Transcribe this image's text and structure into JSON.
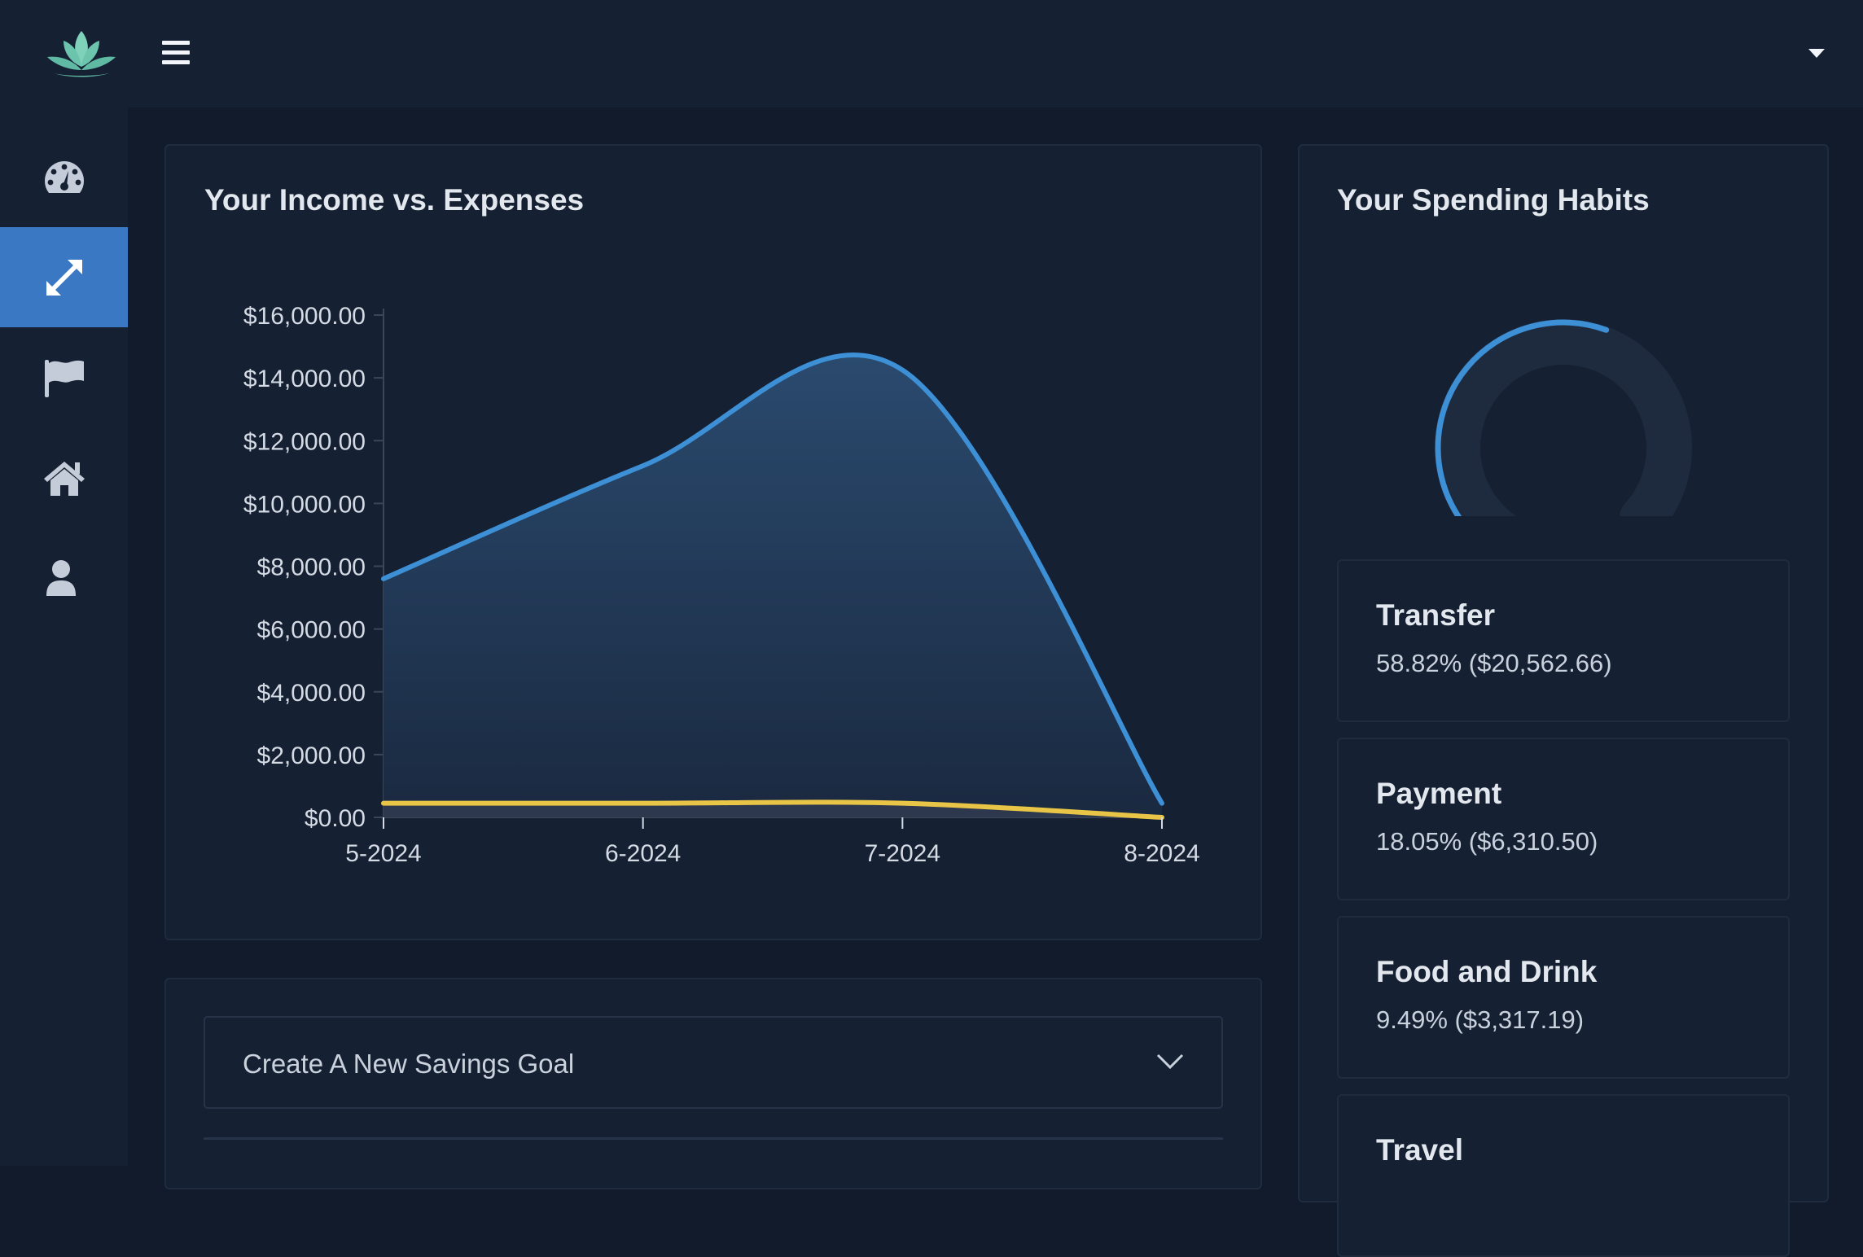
{
  "sidebar": {
    "items": [
      {
        "icon": "dashboard-gauge-icon",
        "active": false
      },
      {
        "icon": "expand-arrows-icon",
        "active": true
      },
      {
        "icon": "flag-icon",
        "active": false
      },
      {
        "icon": "home-icon",
        "active": false
      },
      {
        "icon": "user-icon",
        "active": false
      }
    ]
  },
  "header": {
    "logo_icon": "lotus-icon",
    "menu_icon": "hamburger-menu-icon",
    "user_menu_icon": "caret-down-icon"
  },
  "income_card": {
    "title": "Your Income vs. Expenses"
  },
  "chart_data": {
    "type": "area",
    "title": "Your Income vs. Expenses",
    "categories": [
      "5-2024",
      "6-2024",
      "7-2024",
      "8-2024"
    ],
    "y_ticks": [
      "$0.00",
      "$2,000.00",
      "$4,000.00",
      "$6,000.00",
      "$8,000.00",
      "$10,000.00",
      "$12,000.00",
      "$14,000.00",
      "$16,000.00"
    ],
    "ylim": [
      0,
      16000
    ],
    "series": [
      {
        "values": [
          7600,
          11200,
          14250,
          450
        ],
        "color": "#3d8fd6"
      },
      {
        "values": [
          450,
          450,
          450,
          0
        ],
        "color": "#e8c547"
      }
    ],
    "grid": false
  },
  "spending_card": {
    "title": "Your Spending Habits",
    "habits": [
      {
        "name": "Transfer",
        "value": "58.82% ($20,562.66)"
      },
      {
        "name": "Payment",
        "value": "18.05% ($6,310.50)"
      },
      {
        "name": "Food and Drink",
        "value": "9.49% ($3,317.19)"
      },
      {
        "name": "Travel",
        "value": ""
      }
    ],
    "colors": {
      "track": "#1e2a3e",
      "primary": "#3d8fd6",
      "secondary": "#e8c547",
      "tertiary": "#2458a8"
    }
  },
  "savings_card": {
    "select_label": "Create A New Savings Goal",
    "chevron_icon": "chevron-down-icon"
  }
}
